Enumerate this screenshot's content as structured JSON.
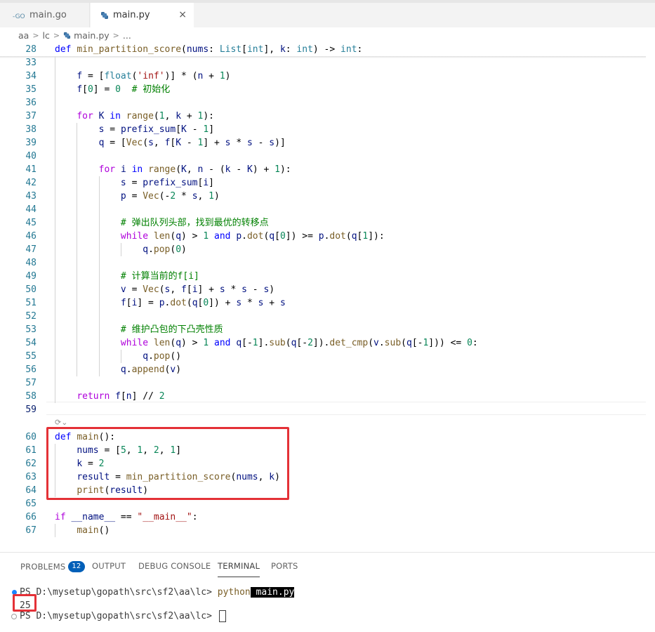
{
  "tabs": [
    {
      "label": "main.go",
      "icon": "go-file-icon",
      "active": false
    },
    {
      "label": "main.py",
      "icon": "python-file-icon",
      "active": true
    }
  ],
  "tab_close_glyph": "×",
  "breadcrumb": [
    "aa",
    "lc",
    "main.py",
    "..."
  ],
  "sticky": {
    "ln": "28",
    "parts": [
      [
        "kw",
        "def"
      ],
      [
        "",
        " "
      ],
      [
        "fn",
        "min_partition_score"
      ],
      [
        "",
        "("
      ],
      [
        "pr",
        "nums"
      ],
      [
        "",
        ": "
      ],
      [
        "ty",
        "List"
      ],
      [
        "",
        "["
      ],
      [
        "ty",
        "int"
      ],
      [
        "",
        "], "
      ],
      [
        "pr",
        "k"
      ],
      [
        "",
        ": "
      ],
      [
        "ty",
        "int"
      ],
      [
        "",
        ") -> "
      ],
      [
        "ty",
        "int"
      ],
      [
        "",
        ":"
      ]
    ]
  },
  "lines": [
    {
      "ln": "33",
      "parts": []
    },
    {
      "ln": "34",
      "parts": [
        [
          "",
          "    "
        ],
        [
          "pr",
          "f"
        ],
        [
          "",
          " = ["
        ],
        [
          "ty",
          "float"
        ],
        [
          "",
          "("
        ],
        [
          "st",
          "'inf'"
        ],
        [
          "",
          ")] * ("
        ],
        [
          "pr",
          "n"
        ],
        [
          "",
          " + "
        ],
        [
          "nu",
          "1"
        ],
        [
          "",
          ")"
        ]
      ]
    },
    {
      "ln": "35",
      "parts": [
        [
          "",
          "    "
        ],
        [
          "pr",
          "f"
        ],
        [
          "",
          "["
        ],
        [
          "nu",
          "0"
        ],
        [
          "",
          "] = "
        ],
        [
          "nu",
          "0"
        ],
        [
          "",
          "  "
        ],
        [
          "cm",
          "# 初始化"
        ]
      ]
    },
    {
      "ln": "36",
      "parts": []
    },
    {
      "ln": "37",
      "parts": [
        [
          "",
          "    "
        ],
        [
          "kc",
          "for"
        ],
        [
          "",
          " "
        ],
        [
          "pr",
          "K"
        ],
        [
          "",
          " "
        ],
        [
          "kw",
          "in"
        ],
        [
          "",
          " "
        ],
        [
          "fn",
          "range"
        ],
        [
          "",
          "("
        ],
        [
          "nu",
          "1"
        ],
        [
          "",
          ", "
        ],
        [
          "pr",
          "k"
        ],
        [
          "",
          " + "
        ],
        [
          "nu",
          "1"
        ],
        [
          "",
          "):"
        ]
      ]
    },
    {
      "ln": "38",
      "parts": [
        [
          "",
          "        "
        ],
        [
          "pr",
          "s"
        ],
        [
          "",
          " = "
        ],
        [
          "pr",
          "prefix_sum"
        ],
        [
          "",
          "["
        ],
        [
          "pr",
          "K"
        ],
        [
          "",
          " - "
        ],
        [
          "nu",
          "1"
        ],
        [
          "",
          "]"
        ]
      ]
    },
    {
      "ln": "39",
      "parts": [
        [
          "",
          "        "
        ],
        [
          "pr",
          "q"
        ],
        [
          "",
          " = ["
        ],
        [
          "fn",
          "Vec"
        ],
        [
          "",
          "("
        ],
        [
          "pr",
          "s"
        ],
        [
          "",
          ", "
        ],
        [
          "pr",
          "f"
        ],
        [
          "",
          "["
        ],
        [
          "pr",
          "K"
        ],
        [
          "",
          " - "
        ],
        [
          "nu",
          "1"
        ],
        [
          "",
          "] + "
        ],
        [
          "pr",
          "s"
        ],
        [
          "",
          " * "
        ],
        [
          "pr",
          "s"
        ],
        [
          "",
          " - "
        ],
        [
          "pr",
          "s"
        ],
        [
          "",
          ")]"
        ]
      ]
    },
    {
      "ln": "40",
      "parts": []
    },
    {
      "ln": "41",
      "parts": [
        [
          "",
          "        "
        ],
        [
          "kc",
          "for"
        ],
        [
          "",
          " "
        ],
        [
          "pr",
          "i"
        ],
        [
          "",
          " "
        ],
        [
          "kw",
          "in"
        ],
        [
          "",
          " "
        ],
        [
          "fn",
          "range"
        ],
        [
          "",
          "("
        ],
        [
          "pr",
          "K"
        ],
        [
          "",
          ", "
        ],
        [
          "pr",
          "n"
        ],
        [
          "",
          " - ("
        ],
        [
          "pr",
          "k"
        ],
        [
          "",
          " - "
        ],
        [
          "pr",
          "K"
        ],
        [
          "",
          ") + "
        ],
        [
          "nu",
          "1"
        ],
        [
          "",
          "):"
        ]
      ]
    },
    {
      "ln": "42",
      "parts": [
        [
          "",
          "            "
        ],
        [
          "pr",
          "s"
        ],
        [
          "",
          " = "
        ],
        [
          "pr",
          "prefix_sum"
        ],
        [
          "",
          "["
        ],
        [
          "pr",
          "i"
        ],
        [
          "",
          "]"
        ]
      ]
    },
    {
      "ln": "43",
      "parts": [
        [
          "",
          "            "
        ],
        [
          "pr",
          "p"
        ],
        [
          "",
          " = "
        ],
        [
          "fn",
          "Vec"
        ],
        [
          "",
          "(-"
        ],
        [
          "nu",
          "2"
        ],
        [
          "",
          " * "
        ],
        [
          "pr",
          "s"
        ],
        [
          "",
          ", "
        ],
        [
          "nu",
          "1"
        ],
        [
          "",
          ")"
        ]
      ]
    },
    {
      "ln": "44",
      "parts": []
    },
    {
      "ln": "45",
      "parts": [
        [
          "",
          "            "
        ],
        [
          "cm",
          "# 弹出队列头部，找到最优的转移点"
        ]
      ]
    },
    {
      "ln": "46",
      "parts": [
        [
          "",
          "            "
        ],
        [
          "kc",
          "while"
        ],
        [
          "",
          " "
        ],
        [
          "fn",
          "len"
        ],
        [
          "",
          "("
        ],
        [
          "pr",
          "q"
        ],
        [
          "",
          ") > "
        ],
        [
          "nu",
          "1"
        ],
        [
          "",
          " "
        ],
        [
          "kw",
          "and"
        ],
        [
          "",
          " "
        ],
        [
          "pr",
          "p"
        ],
        [
          "",
          "."
        ],
        [
          "fn",
          "dot"
        ],
        [
          "",
          "("
        ],
        [
          "pr",
          "q"
        ],
        [
          "",
          "["
        ],
        [
          "nu",
          "0"
        ],
        [
          "",
          "]) >= "
        ],
        [
          "pr",
          "p"
        ],
        [
          "",
          "."
        ],
        [
          "fn",
          "dot"
        ],
        [
          "",
          "("
        ],
        [
          "pr",
          "q"
        ],
        [
          "",
          "["
        ],
        [
          "nu",
          "1"
        ],
        [
          "",
          "]):"
        ]
      ]
    },
    {
      "ln": "47",
      "parts": [
        [
          "",
          "                "
        ],
        [
          "pr",
          "q"
        ],
        [
          "",
          "."
        ],
        [
          "fn",
          "pop"
        ],
        [
          "",
          "("
        ],
        [
          "nu",
          "0"
        ],
        [
          "",
          ")"
        ]
      ]
    },
    {
      "ln": "48",
      "parts": []
    },
    {
      "ln": "49",
      "parts": [
        [
          "",
          "            "
        ],
        [
          "cm",
          "# 计算当前的f[i]"
        ]
      ]
    },
    {
      "ln": "50",
      "parts": [
        [
          "",
          "            "
        ],
        [
          "pr",
          "v"
        ],
        [
          "",
          " = "
        ],
        [
          "fn",
          "Vec"
        ],
        [
          "",
          "("
        ],
        [
          "pr",
          "s"
        ],
        [
          "",
          ", "
        ],
        [
          "pr",
          "f"
        ],
        [
          "",
          "["
        ],
        [
          "pr",
          "i"
        ],
        [
          "",
          "] + "
        ],
        [
          "pr",
          "s"
        ],
        [
          "",
          " * "
        ],
        [
          "pr",
          "s"
        ],
        [
          "",
          " - "
        ],
        [
          "pr",
          "s"
        ],
        [
          "",
          ")"
        ]
      ]
    },
    {
      "ln": "51",
      "parts": [
        [
          "",
          "            "
        ],
        [
          "pr",
          "f"
        ],
        [
          "",
          "["
        ],
        [
          "pr",
          "i"
        ],
        [
          "",
          "] = "
        ],
        [
          "pr",
          "p"
        ],
        [
          "",
          "."
        ],
        [
          "fn",
          "dot"
        ],
        [
          "",
          "("
        ],
        [
          "pr",
          "q"
        ],
        [
          "",
          "["
        ],
        [
          "nu",
          "0"
        ],
        [
          "",
          "]) + "
        ],
        [
          "pr",
          "s"
        ],
        [
          "",
          " * "
        ],
        [
          "pr",
          "s"
        ],
        [
          "",
          " + "
        ],
        [
          "pr",
          "s"
        ]
      ]
    },
    {
      "ln": "52",
      "parts": []
    },
    {
      "ln": "53",
      "parts": [
        [
          "",
          "            "
        ],
        [
          "cm",
          "# 维护凸包的下凸壳性质"
        ]
      ]
    },
    {
      "ln": "54",
      "parts": [
        [
          "",
          "            "
        ],
        [
          "kc",
          "while"
        ],
        [
          "",
          " "
        ],
        [
          "fn",
          "len"
        ],
        [
          "",
          "("
        ],
        [
          "pr",
          "q"
        ],
        [
          "",
          ") > "
        ],
        [
          "nu",
          "1"
        ],
        [
          "",
          " "
        ],
        [
          "kw",
          "and"
        ],
        [
          "",
          " "
        ],
        [
          "pr",
          "q"
        ],
        [
          "",
          "[-"
        ],
        [
          "nu",
          "1"
        ],
        [
          "",
          "]."
        ],
        [
          "fn",
          "sub"
        ],
        [
          "",
          "("
        ],
        [
          "pr",
          "q"
        ],
        [
          "",
          "[-"
        ],
        [
          "nu",
          "2"
        ],
        [
          "",
          "])."
        ],
        [
          "fn",
          "det_cmp"
        ],
        [
          "",
          "("
        ],
        [
          "pr",
          "v"
        ],
        [
          "",
          "."
        ],
        [
          "fn",
          "sub"
        ],
        [
          "",
          "("
        ],
        [
          "pr",
          "q"
        ],
        [
          "",
          "[-"
        ],
        [
          "nu",
          "1"
        ],
        [
          "",
          "])) <= "
        ],
        [
          "nu",
          "0"
        ],
        [
          "",
          ":"
        ]
      ]
    },
    {
      "ln": "55",
      "parts": [
        [
          "",
          "                "
        ],
        [
          "pr",
          "q"
        ],
        [
          "",
          "."
        ],
        [
          "fn",
          "pop"
        ],
        [
          "",
          "()"
        ]
      ]
    },
    {
      "ln": "56",
      "parts": [
        [
          "",
          "            "
        ],
        [
          "pr",
          "q"
        ],
        [
          "",
          "."
        ],
        [
          "fn",
          "append"
        ],
        [
          "",
          "("
        ],
        [
          "pr",
          "v"
        ],
        [
          "",
          ")"
        ]
      ]
    },
    {
      "ln": "57",
      "parts": []
    },
    {
      "ln": "58",
      "parts": [
        [
          "",
          "    "
        ],
        [
          "kc",
          "return"
        ],
        [
          "",
          " "
        ],
        [
          "pr",
          "f"
        ],
        [
          "",
          "["
        ],
        [
          "pr",
          "n"
        ],
        [
          "",
          "] // "
        ],
        [
          "nu",
          "2"
        ]
      ]
    },
    {
      "ln": "59",
      "parts": []
    },
    {
      "ln": "60",
      "parts": [
        [
          "kw",
          "def"
        ],
        [
          "",
          " "
        ],
        [
          "fn",
          "main"
        ],
        [
          "",
          "():"
        ]
      ]
    },
    {
      "ln": "61",
      "parts": [
        [
          "",
          "    "
        ],
        [
          "pr",
          "nums"
        ],
        [
          "",
          " = ["
        ],
        [
          "nu",
          "5"
        ],
        [
          "",
          ", "
        ],
        [
          "nu",
          "1"
        ],
        [
          "",
          ", "
        ],
        [
          "nu",
          "2"
        ],
        [
          "",
          ", "
        ],
        [
          "nu",
          "1"
        ],
        [
          "",
          "]"
        ]
      ]
    },
    {
      "ln": "62",
      "parts": [
        [
          "",
          "    "
        ],
        [
          "pr",
          "k"
        ],
        [
          "",
          " = "
        ],
        [
          "nu",
          "2"
        ]
      ]
    },
    {
      "ln": "63",
      "parts": [
        [
          "",
          "    "
        ],
        [
          "pr",
          "result"
        ],
        [
          "",
          " = "
        ],
        [
          "fn",
          "min_partition_score"
        ],
        [
          "",
          "("
        ],
        [
          "pr",
          "nums"
        ],
        [
          "",
          ", "
        ],
        [
          "pr",
          "k"
        ],
        [
          "",
          ")"
        ]
      ]
    },
    {
      "ln": "64",
      "parts": [
        [
          "",
          "    "
        ],
        [
          "fn",
          "print"
        ],
        [
          "",
          "("
        ],
        [
          "pr",
          "result"
        ],
        [
          "",
          ")"
        ]
      ]
    },
    {
      "ln": "65",
      "parts": []
    },
    {
      "ln": "66",
      "parts": [
        [
          "kc",
          "if"
        ],
        [
          "",
          " "
        ],
        [
          "pr",
          "__name__"
        ],
        [
          "",
          " == "
        ],
        [
          "st",
          "\"__main__\""
        ],
        [
          "",
          ":"
        ]
      ]
    },
    {
      "ln": "67",
      "parts": [
        [
          "",
          "    "
        ],
        [
          "fn",
          "main"
        ],
        [
          "",
          "()"
        ]
      ]
    }
  ],
  "codelens_glyph": "⟳⌄",
  "panel": {
    "tabs": [
      "PROBLEMS",
      "OUTPUT",
      "DEBUG CONSOLE",
      "TERMINAL",
      "PORTS"
    ],
    "problems_count": "12",
    "active_tab": "TERMINAL"
  },
  "terminal": {
    "line1_prompt": "PS D:\\mysetup\\gopath\\src\\sf2\\aa\\lc> ",
    "line1_cmd": "python",
    "line1_arg": " main.py",
    "line2_output": "25",
    "line3_prompt": "PS D:\\mysetup\\gopath\\src\\sf2\\aa\\lc> "
  }
}
